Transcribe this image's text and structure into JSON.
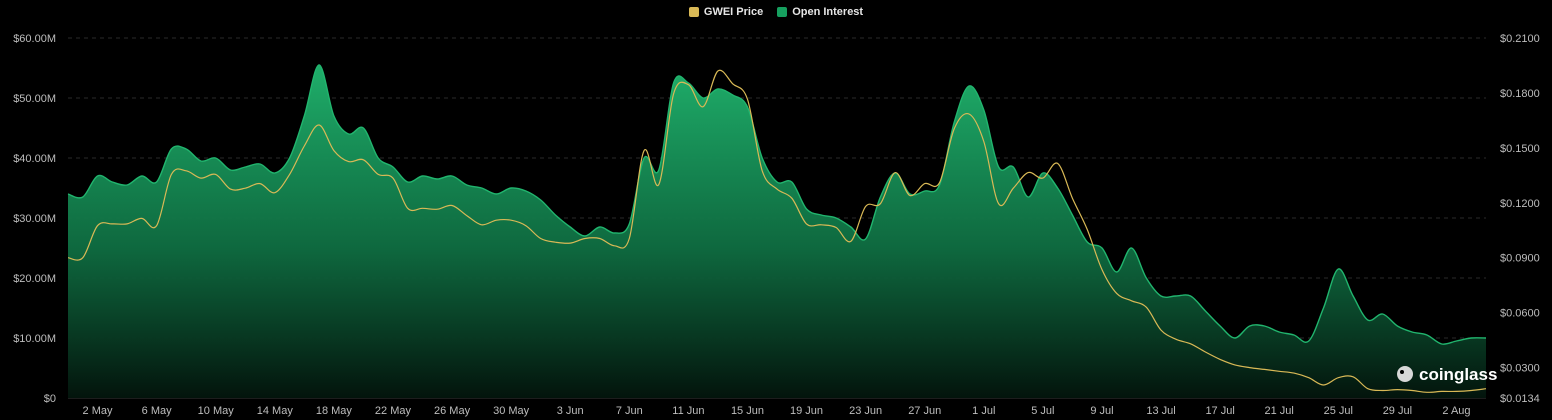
{
  "legend": {
    "price_label": "GWEI Price",
    "oi_label": "Open Interest"
  },
  "watermark": "coinglass",
  "colors": {
    "price": "#d9b956",
    "oi": "#16a05f",
    "grid": "#2a2a2a",
    "background": "#000000"
  },
  "chart_data": {
    "type": "area",
    "title": "",
    "legend_position": "top-center",
    "grid": true,
    "x_labels": [
      "2 May",
      "6 May",
      "10 May",
      "14 May",
      "18 May",
      "22 May",
      "26 May",
      "30 May",
      "3 Jun",
      "7 Jun",
      "11 Jun",
      "15 Jun",
      "19 Jun",
      "23 Jun",
      "27 Jun",
      "1 Jul",
      "5 Jul",
      "9 Jul",
      "13 Jul",
      "17 Jul",
      "21 Jul",
      "25 Jul",
      "29 Jul",
      "2 Aug"
    ],
    "left_axis": {
      "ticks": [
        "$0",
        "$10.00M",
        "$20.00M",
        "$30.00M",
        "$40.00M",
        "$50.00M",
        "$60.00M"
      ],
      "range": [
        0,
        60
      ]
    },
    "right_axis": {
      "ticks": [
        "$0.0134",
        "$0.0300",
        "$0.0600",
        "$0.0900",
        "$0.1200",
        "$0.1500",
        "$0.1800",
        "$0.2100"
      ],
      "range": [
        0.0134,
        0.21
      ]
    },
    "series": [
      {
        "name": "Open Interest",
        "axis": "left",
        "unit": "$M",
        "x_day_index": [
          0,
          1,
          2,
          3,
          4,
          5,
          6,
          7,
          8,
          9,
          10,
          11,
          12,
          13,
          14,
          15,
          16,
          17,
          18,
          19,
          20,
          21,
          22,
          23,
          24,
          25,
          26,
          27,
          28,
          29,
          30,
          31,
          32,
          33,
          34,
          35,
          36,
          37,
          38,
          39,
          40,
          41,
          42,
          43,
          44,
          45,
          46,
          47,
          48,
          49,
          50,
          51,
          52,
          53,
          54,
          55,
          56,
          57,
          58,
          59,
          60,
          61,
          62,
          63,
          64,
          65,
          66,
          67,
          68,
          69,
          70,
          71,
          72,
          73,
          74,
          75,
          76,
          77,
          78,
          79,
          80,
          81,
          82,
          83,
          84,
          85,
          86,
          87,
          88,
          89,
          90,
          91,
          92,
          93,
          94,
          95,
          96
        ],
        "values": [
          34,
          33.5,
          37,
          36,
          35.5,
          37,
          36,
          41.5,
          41.5,
          39.5,
          40,
          38,
          38.5,
          39,
          37.5,
          40,
          47,
          55.5,
          47,
          44,
          45,
          40,
          38.5,
          36,
          37,
          36.5,
          37,
          35.5,
          35,
          34,
          35,
          34.5,
          33,
          30.5,
          28.5,
          27,
          28.5,
          27.5,
          29,
          40,
          38,
          52.5,
          52.5,
          50,
          51.5,
          50.5,
          48.5,
          40,
          36,
          36,
          31.5,
          30.5,
          30,
          28.5,
          26.5,
          33.5,
          37.5,
          34,
          34.5,
          35.5,
          46,
          52,
          48,
          38.5,
          38.5,
          33.5,
          37.5,
          35,
          30.5,
          26,
          25,
          21,
          25,
          20,
          17,
          17,
          17,
          14.5,
          12,
          10,
          12,
          12,
          11,
          10.5,
          9.5,
          15,
          21.5,
          17,
          13,
          14,
          12,
          11,
          10.5,
          9,
          9.5,
          10,
          10
        ]
      },
      {
        "name": "GWEI Price",
        "axis": "right",
        "unit": "$",
        "x_day_index": [
          0,
          1,
          2,
          3,
          4,
          5,
          6,
          7,
          8,
          9,
          10,
          11,
          12,
          13,
          14,
          15,
          16,
          17,
          18,
          19,
          20,
          21,
          22,
          23,
          24,
          25,
          26,
          27,
          28,
          29,
          30,
          31,
          32,
          33,
          34,
          35,
          36,
          37,
          38,
          39,
          40,
          41,
          42,
          43,
          44,
          45,
          46,
          47,
          48,
          49,
          50,
          51,
          52,
          53,
          54,
          55,
          56,
          57,
          58,
          59,
          60,
          61,
          62,
          63,
          64,
          65,
          66,
          67,
          68,
          69,
          70,
          71,
          72,
          73,
          74,
          75,
          76,
          77,
          78,
          79,
          80,
          81,
          82,
          83,
          84,
          85,
          86,
          87,
          88,
          89,
          90,
          91,
          92,
          93,
          94,
          95,
          96
        ],
        "values": [
          0.09,
          0.09,
          0.1075,
          0.1085,
          0.1085,
          0.1115,
          0.1075,
          0.1355,
          0.1375,
          0.1335,
          0.1355,
          0.1275,
          0.128,
          0.1305,
          0.1255,
          0.1355,
          0.151,
          0.1625,
          0.1485,
          0.1425,
          0.1435,
          0.1355,
          0.1335,
          0.117,
          0.117,
          0.1165,
          0.1185,
          0.113,
          0.108,
          0.1105,
          0.1105,
          0.1075,
          0.1005,
          0.0985,
          0.098,
          0.1005,
          0.1005,
          0.0965,
          0.1005,
          0.1485,
          0.13,
          0.1795,
          0.1845,
          0.1725,
          0.192,
          0.185,
          0.1765,
          0.1375,
          0.1275,
          0.1225,
          0.1085,
          0.108,
          0.1065,
          0.099,
          0.118,
          0.1195,
          0.1365,
          0.124,
          0.1305,
          0.131,
          0.1605,
          0.1685,
          0.1535,
          0.1195,
          0.128,
          0.1365,
          0.1335,
          0.1415,
          0.1225,
          0.1055,
          0.0835,
          0.0705,
          0.0665,
          0.063,
          0.0505,
          0.0455,
          0.043,
          0.0385,
          0.0345,
          0.0315,
          0.03,
          0.029,
          0.028,
          0.027,
          0.0245,
          0.0205,
          0.0245,
          0.025,
          0.0185,
          0.0175,
          0.018,
          0.0175,
          0.0165,
          0.017,
          0.017,
          0.0175,
          0.0185
        ]
      }
    ]
  }
}
